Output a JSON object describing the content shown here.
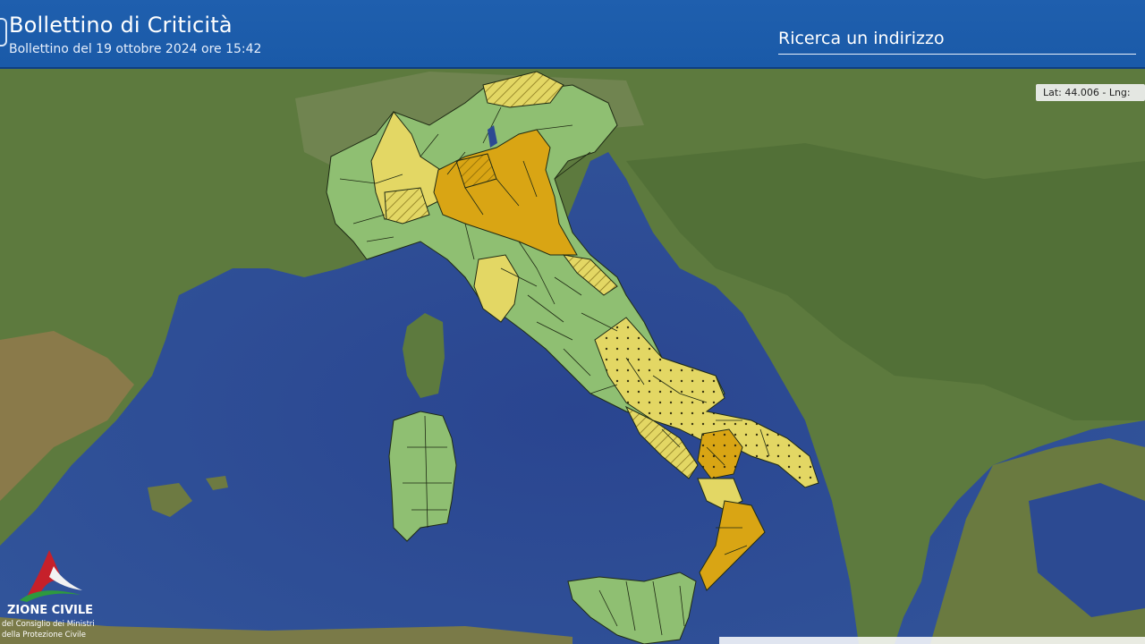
{
  "header": {
    "title": "Bollettino di Criticità",
    "subtitle": "Bollettino del 19 ottobre 2024 ore 15:42",
    "search_placeholder": "Ricerca un indirizzo"
  },
  "map": {
    "coordinates_readout": "Lat: 44.006 - Lng:",
    "colors": {
      "sea": "#2c4a92",
      "land": "#5d7a3e",
      "green_zone": "#8fbf72",
      "yellow_zone": "#e3d764",
      "orange_zone": "#d9a514",
      "boundary": "#1f2a14"
    },
    "legend_levels": [
      "green",
      "yellow",
      "orange"
    ]
  },
  "logo": {
    "name": "ZIONE CIVILE",
    "line1": "del Consiglio dei Ministri",
    "line2": "della Protezione Civile"
  }
}
